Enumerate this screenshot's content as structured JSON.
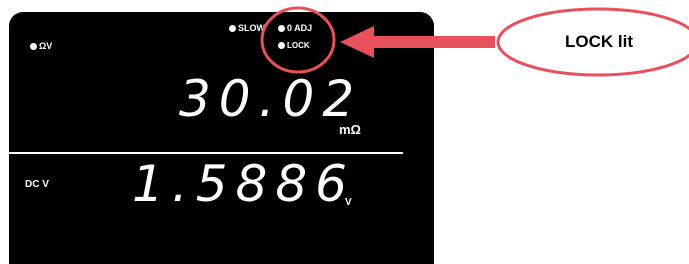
{
  "display": {
    "indicators": {
      "ohm_v": "ΩV",
      "slow": "SLOW",
      "zero_adj": "0 ADJ",
      "lock": "LOCK"
    },
    "primary": {
      "value": "30.02",
      "unit": "mΩ"
    },
    "secondary": {
      "label": "DC V",
      "value": "1.5886",
      "unit": "V"
    }
  },
  "callout": {
    "text": "LOCK lit",
    "colors": {
      "highlight": "#e8515b",
      "arrow": "#e8515b"
    }
  }
}
